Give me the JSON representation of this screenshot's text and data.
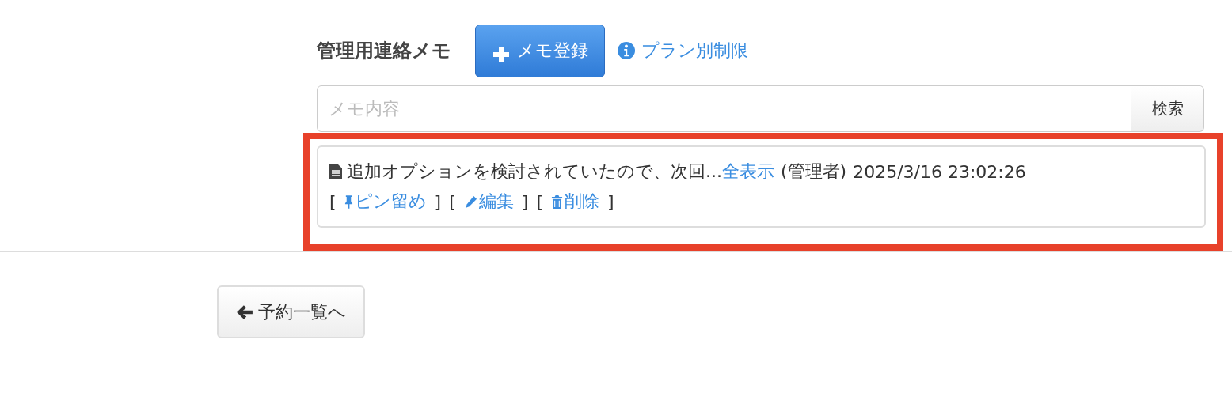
{
  "section_title": "管理用連絡メモ",
  "register_button": {
    "label": "メモ登録"
  },
  "plan_link": {
    "label": "プラン別制限"
  },
  "search": {
    "placeholder": "メモ内容",
    "button": "検索"
  },
  "memos": [
    {
      "text": "追加オプションを検討されていたので、次回...",
      "show_all": "全表示",
      "author": "(管理者)",
      "timestamp": "2025/3/16 23:02:26",
      "actions": [
        {
          "kind": "pin",
          "open": "[",
          "label": "ピン留め",
          "close": "]"
        },
        {
          "kind": "edit",
          "open": "[",
          "label": "編集",
          "close": "]"
        },
        {
          "kind": "delete",
          "open": "[",
          "label": "削除",
          "close": "]"
        }
      ]
    }
  ],
  "back_button": {
    "label": "予約一覧へ"
  }
}
